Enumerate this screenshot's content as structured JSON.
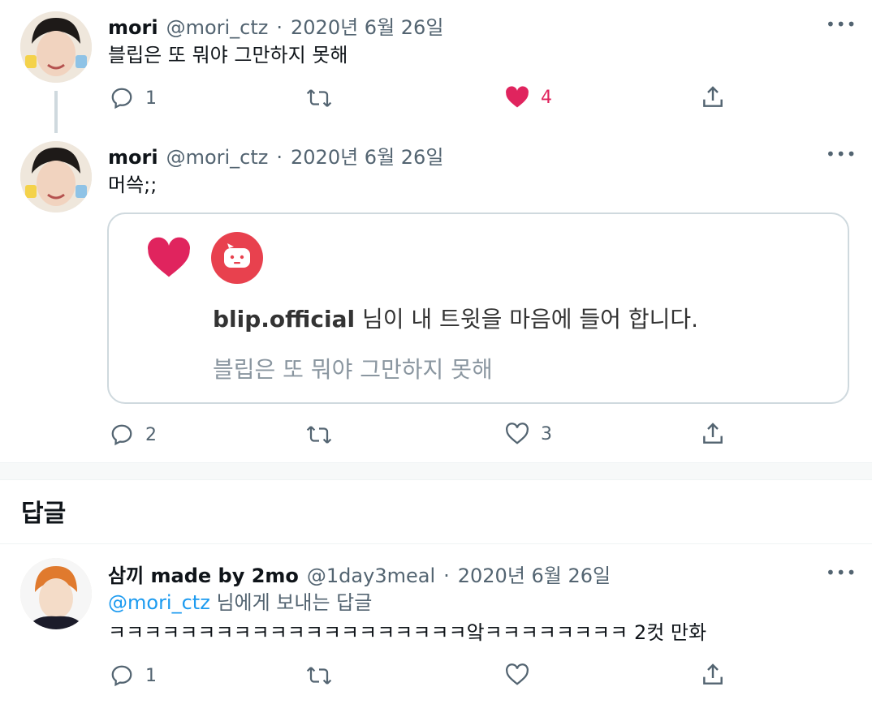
{
  "tweet1": {
    "name": "mori",
    "handle": "@mori_ctz",
    "sep": "·",
    "date": "2020년 6월 26일",
    "text": "블립은 또 뭐야 그만하지 못해",
    "replies": "1",
    "likes": "4",
    "liked": true
  },
  "tweet2": {
    "name": "mori",
    "handle": "@mori_ctz",
    "sep": "·",
    "date": "2020년 6월 26일",
    "text": "머쓱;;",
    "replies": "2",
    "likes": "3",
    "card": {
      "account": "blip.official",
      "message": " 님이 내 트윗을 마음에 들어 합니다.",
      "quoted": "블립은 또 뭐야 그만하지 못해"
    }
  },
  "section": {
    "title": "답글"
  },
  "reply1": {
    "name": "삼끼 made by 2mo",
    "handle": "@1day3meal",
    "sep": "·",
    "date": "2020년 6월 26일",
    "reply_to_handle": "@mori_ctz",
    "reply_to_suffix": " 님에게 보내는 답글",
    "text": "ㅋㅋㅋㅋㅋㅋㅋㅋㅋㅋㅋㅋㅋㅋㅋㅋㅋㅋㅋㅋ앜ㅋㅋㅋㅋㅋㅋㅋㅋ 2컷 만화",
    "replies": "1"
  },
  "colors": {
    "like": "#e0245e",
    "link": "#1d9bf0",
    "muted": "#536471",
    "blip": "#e8414e"
  },
  "icons": [
    "more-icon",
    "reply-icon",
    "retweet-icon",
    "heart-icon",
    "share-icon"
  ]
}
